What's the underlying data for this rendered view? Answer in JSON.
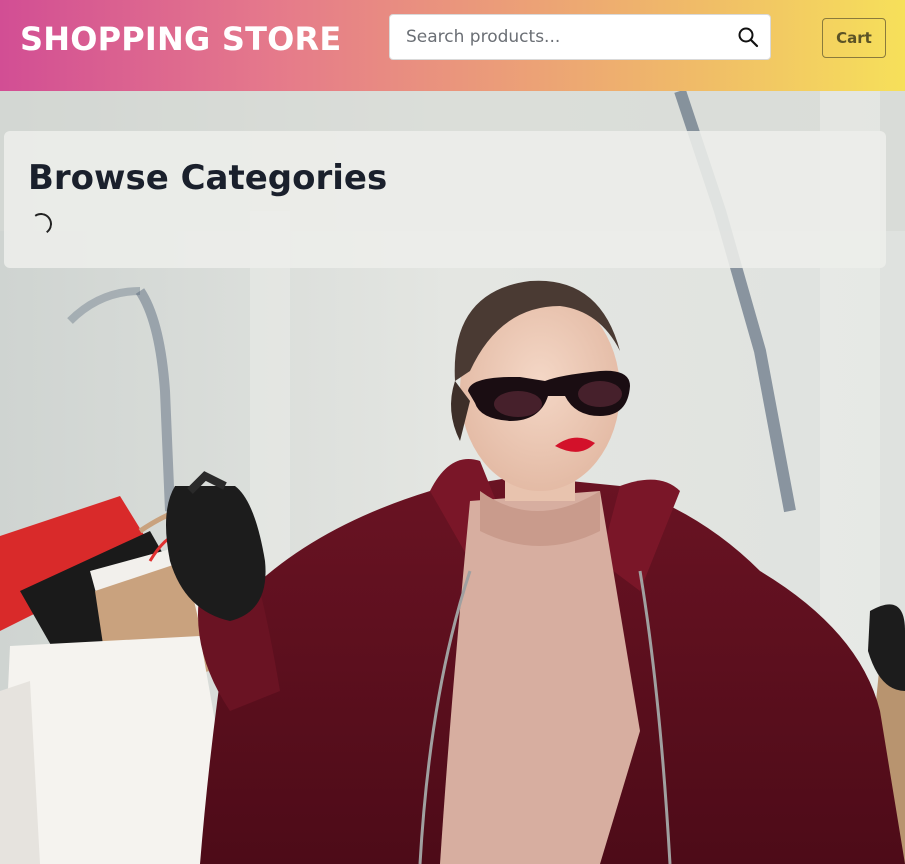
{
  "header": {
    "logo_text": "SHOPPING STORE",
    "search": {
      "placeholder": "Search products...",
      "value": ""
    },
    "search_button_icon": "search-icon",
    "cart_label": "Cart"
  },
  "main": {
    "categories_title": "Browse Categories",
    "loading_indicator": "spinner"
  },
  "colors": {
    "header_gradient_start": "#d24e94",
    "header_gradient_end": "#f6e05a",
    "title_text": "#1a202c"
  }
}
